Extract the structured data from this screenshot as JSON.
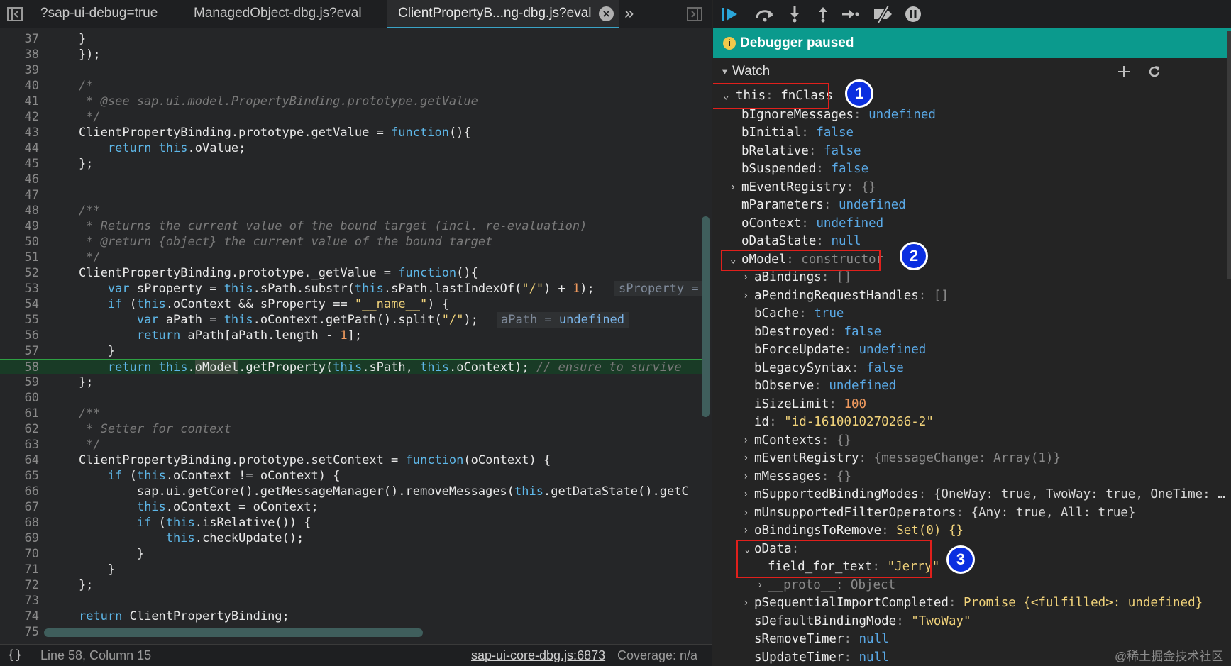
{
  "editor": {
    "tabs": [
      {
        "label": "?sap-ui-debug=true"
      },
      {
        "label": "ManagedObject-dbg.js?eval"
      },
      {
        "label": "ClientPropertyB...ng-dbg.js?eval"
      }
    ],
    "more_label": "»",
    "lines": [
      {
        "n": "37"
      },
      {
        "n": "38"
      },
      {
        "n": "39"
      },
      {
        "n": "40"
      },
      {
        "n": "41"
      },
      {
        "n": "42"
      },
      {
        "n": "43"
      },
      {
        "n": "44"
      },
      {
        "n": "45"
      },
      {
        "n": "46"
      },
      {
        "n": "47"
      },
      {
        "n": "48"
      },
      {
        "n": "49"
      },
      {
        "n": "50"
      },
      {
        "n": "51"
      },
      {
        "n": "52"
      },
      {
        "n": "53"
      },
      {
        "n": "54"
      },
      {
        "n": "55"
      },
      {
        "n": "56"
      },
      {
        "n": "57"
      },
      {
        "n": "58"
      },
      {
        "n": "59"
      },
      {
        "n": "60"
      },
      {
        "n": "61"
      },
      {
        "n": "62"
      },
      {
        "n": "63"
      },
      {
        "n": "64"
      },
      {
        "n": "65"
      },
      {
        "n": "66"
      },
      {
        "n": "67"
      },
      {
        "n": "68"
      },
      {
        "n": "69"
      },
      {
        "n": "70"
      },
      {
        "n": "71"
      },
      {
        "n": "72"
      },
      {
        "n": "73"
      },
      {
        "n": "74"
      },
      {
        "n": "75"
      }
    ],
    "inline_values": {
      "sProperty": "sProperty =",
      "aPath_name": "aPath =",
      "aPath_value": "undefined"
    },
    "status": {
      "position": "Line 58, Column 15",
      "source": "sap-ui-core-dbg.js:6873",
      "coverage": "Coverage: n/a"
    }
  },
  "debugger": {
    "paused_label": "Debugger paused",
    "watch_label": "Watch",
    "root": {
      "key": "this",
      "value": "fnClass"
    },
    "rows": [
      {
        "key": "bIgnoreMessages",
        "value": "undefined"
      },
      {
        "key": "bInitial",
        "value": "false"
      },
      {
        "key": "bRelative",
        "value": "false"
      },
      {
        "key": "bSuspended",
        "value": "false"
      },
      {
        "key": "mEventRegistry",
        "value": "{}"
      },
      {
        "key": "mParameters",
        "value": "undefined"
      },
      {
        "key": "oContext",
        "value": "undefined"
      },
      {
        "key": "oDataState",
        "value": "null"
      },
      {
        "key": "oModel",
        "value": "constructor"
      },
      {
        "key": "aBindings",
        "value": "[]"
      },
      {
        "key": "aPendingRequestHandles",
        "value": "[]"
      },
      {
        "key": "bCache",
        "value": "true"
      },
      {
        "key": "bDestroyed",
        "value": "false"
      },
      {
        "key": "bForceUpdate",
        "value": "undefined"
      },
      {
        "key": "bLegacySyntax",
        "value": "false"
      },
      {
        "key": "bObserve",
        "value": "undefined"
      },
      {
        "key": "iSizeLimit",
        "value": "100"
      },
      {
        "key": "id",
        "value": "\"id-1610010270266-2\""
      },
      {
        "key": "mContexts",
        "value": "{}"
      },
      {
        "key": "mEventRegistry",
        "value": "{messageChange: Array(1)}"
      },
      {
        "key": "mMessages",
        "value": "{}"
      },
      {
        "key": "mSupportedBindingModes",
        "value": "{OneWay: true, TwoWay: true, OneTime: …"
      },
      {
        "key": "mUnsupportedFilterOperators",
        "value": "{Any: true, All: true}"
      },
      {
        "key": "oBindingsToRemove",
        "value": "Set(0) {}"
      },
      {
        "key": "oData",
        "value": ""
      },
      {
        "key": "field_for_text",
        "value": "\"Jerry\""
      },
      {
        "key": "__proto__",
        "value": "Object"
      },
      {
        "key": "pSequentialImportCompleted",
        "value": "Promise {<fulfilled>: undefined}"
      },
      {
        "key": "sDefaultBindingMode",
        "value": "\"TwoWay\""
      },
      {
        "key": "sRemoveTimer",
        "value": "null"
      },
      {
        "key": "sUpdateTimer",
        "value": "null"
      }
    ],
    "badges": [
      "1",
      "2",
      "3"
    ]
  },
  "watermark": "@稀土掘金技术社区",
  "colors": {
    "accent": "#0b9a8d",
    "exec_line": "#193b26",
    "badge": "#0b2fe0",
    "annotation_box": "#e0201c"
  }
}
